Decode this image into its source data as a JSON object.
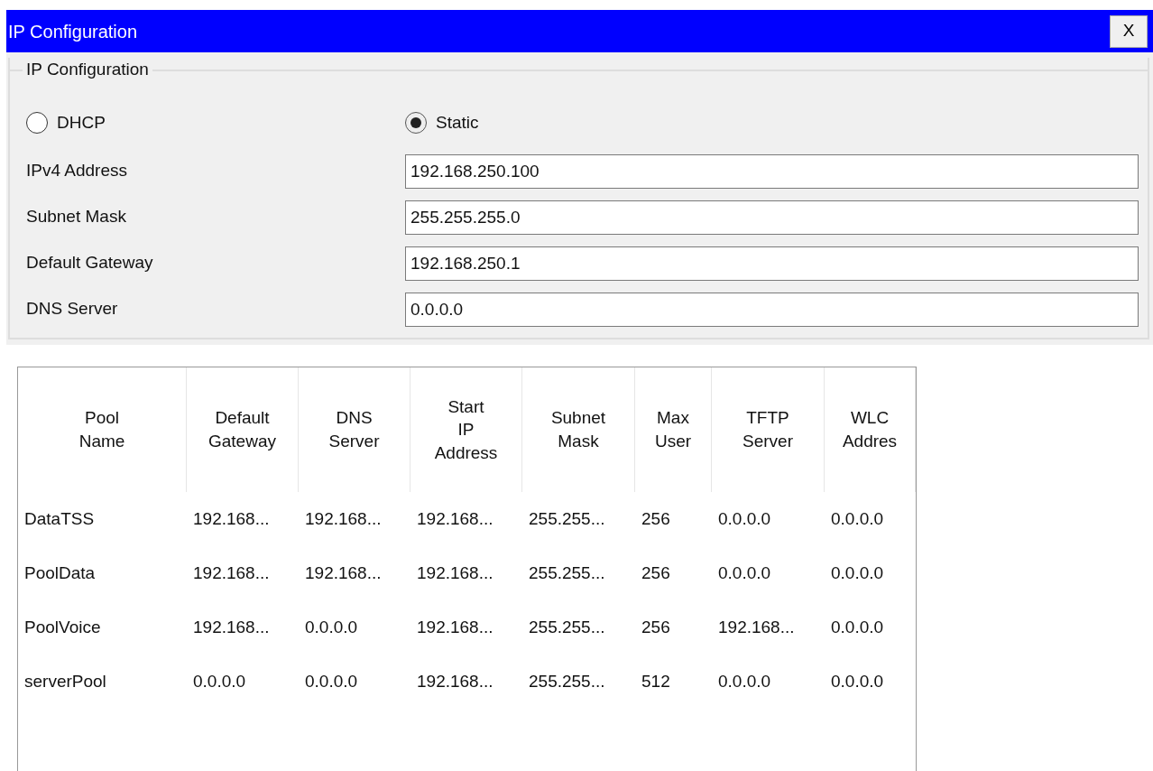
{
  "window": {
    "title": "IP Configuration",
    "close": "X"
  },
  "group": {
    "legend": "IP Configuration",
    "modes": [
      {
        "label": "DHCP",
        "selected": false
      },
      {
        "label": "Static",
        "selected": true
      }
    ],
    "fields": [
      {
        "label": "IPv4 Address",
        "value": "192.168.250.100"
      },
      {
        "label": "Subnet Mask",
        "value": "255.255.255.0"
      },
      {
        "label": "Default Gateway",
        "value": "192.168.250.1"
      },
      {
        "label": "DNS Server",
        "value": "0.0.0.0"
      }
    ]
  },
  "table": {
    "columns": [
      "Pool\nName",
      "Default\nGateway",
      "DNS\nServer",
      "Start\nIP\nAddress",
      "Subnet\nMask",
      "Max\nUser",
      "TFTP\nServer",
      "WLC\nAddres"
    ],
    "rows": [
      [
        "DataTSS",
        "192.168...",
        "192.168...",
        "192.168...",
        "255.255...",
        "256",
        "0.0.0.0",
        "0.0.0.0"
      ],
      [
        "PoolData",
        "192.168...",
        "192.168...",
        "192.168...",
        "255.255...",
        "256",
        "0.0.0.0",
        "0.0.0.0"
      ],
      [
        "PoolVoice",
        "192.168...",
        "0.0.0.0",
        "192.168...",
        "255.255...",
        "256",
        "192.168...",
        "0.0.0.0"
      ],
      [
        "serverPool",
        "0.0.0.0",
        "0.0.0.0",
        "192.168...",
        "255.255...",
        "512",
        "0.0.0.0",
        "0.0.0.0"
      ]
    ]
  }
}
